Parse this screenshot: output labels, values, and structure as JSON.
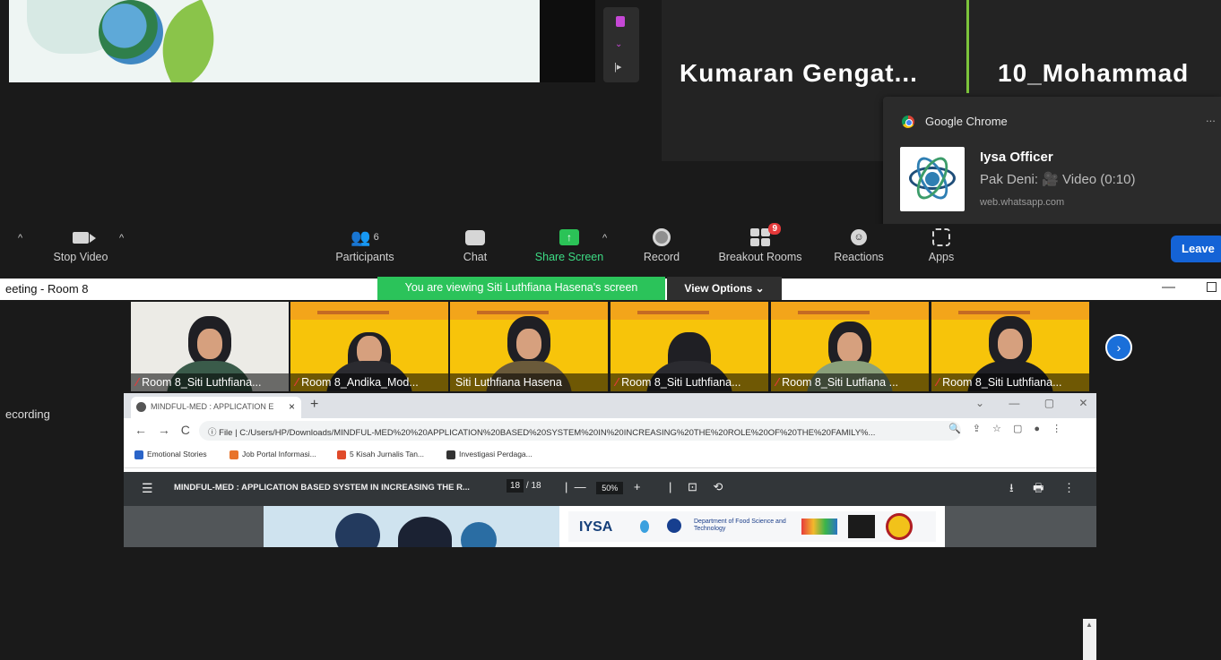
{
  "participants_top": {
    "name_1": "Kumaran  Gengat...",
    "name_2": "10_Mohammad"
  },
  "notification": {
    "app": "Google Chrome",
    "more": "...",
    "title": "Iysa Officer",
    "message": "Pak Deni: 🎥 Video (0:10)",
    "url": "web.whatsapp.com"
  },
  "toolbar": {
    "stop_video": "Stop Video",
    "participants": "Participants",
    "participants_count": "6",
    "chat": "Chat",
    "share_screen": "Share Screen",
    "record": "Record",
    "breakout_rooms": "Breakout Rooms",
    "breakout_badge": "9",
    "reactions": "Reactions",
    "apps": "Apps",
    "leave": "Leave"
  },
  "window": {
    "title": "eeting - Room 8",
    "viewing_banner": "You are viewing Siti Luthfiana Hasena's screen",
    "view_options": "View Options ⌄",
    "recording_label": "ecording"
  },
  "gallery": [
    {
      "name": "Room 8_Siti Luthfiana...",
      "muted": true
    },
    {
      "name": "Room 8_Andika_Mod...",
      "muted": true
    },
    {
      "name": "Siti Luthfiana Hasena",
      "muted": false
    },
    {
      "name": "Room 8_Siti Luthfiana...",
      "muted": true
    },
    {
      "name": "Room 8_Siti Lutfiana ...",
      "muted": true
    },
    {
      "name": "Room 8_Siti Luthfiana...",
      "muted": true
    }
  ],
  "browser": {
    "tab_title": "MINDFUL-MED : APPLICATION E",
    "address": "ⓘ File  |  C:/Users/HP/Downloads/MINDFUL-MED%20%20APPLICATION%20BASED%20SYSTEM%20IN%20INCREASING%20THE%20ROLE%20OF%20THE%20FAMILY%...",
    "bookmarks": [
      "Emotional Stories",
      "Job Portal Informasi...",
      "5 Kisah Jurnalis Tan...",
      "Investigasi Perdaga..."
    ],
    "pdf": {
      "title": "MINDFUL-MED : APPLICATION BASED SYSTEM IN INCREASING THE R...",
      "page_current": "18",
      "page_total": "/ 18",
      "zoom": "50%"
    },
    "slide_logos": {
      "iysa": "IYSA",
      "dept": "Department of Food Science and Technology"
    }
  },
  "colors": {
    "zoom_green": "#2bc35a",
    "leave_blue": "#1463d6",
    "badge_red": "#e5393a",
    "meeting_bg": "#1a1a1a"
  }
}
